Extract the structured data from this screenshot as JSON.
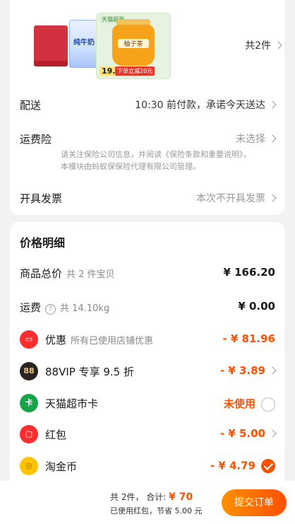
{
  "order_card": {
    "products": [
      {
        "name": "纯牛奶"
      },
      {
        "name": "柚子茶",
        "tag": "天猫超市",
        "price": "19.9",
        "promo": "下单立减20元"
      }
    ],
    "count_label": "共2件",
    "delivery": {
      "label": "配送",
      "value": "10:30 前付款，承诺今天送达"
    },
    "insurance": {
      "label": "运费险",
      "value": "未选择",
      "notice": "请关注保险公司信息，并阅读《保险条款和重要说明》，本模块由蚂蚁保保险代理有限公司管理。"
    },
    "invoice": {
      "label": "开具发票",
      "value": "本次不开具发票"
    }
  },
  "price_card": {
    "title": "价格明细",
    "items": [
      {
        "label": "商品总价",
        "sub": "共 2 件宝贝",
        "value": "¥ 166.20"
      },
      {
        "label": "运费",
        "sub": "共 14.10kg",
        "value": "¥ 0.00"
      },
      {
        "label": "优惠",
        "sub": "所有已使用店铺优惠",
        "value": "- ¥ 81.96",
        "icon": "ticket-icon"
      },
      {
        "label": "88VIP 专享 9.5 折",
        "value": "- ¥ 3.89",
        "icon": "88vip-icon"
      },
      {
        "label": "天猫超市卡",
        "value": "未使用",
        "icon": "supermarket-card-icon"
      },
      {
        "label": "红包",
        "value": "- ¥ 5.00",
        "icon": "red-packet-icon"
      },
      {
        "label": "淘金币",
        "value": "- ¥ 4.79",
        "icon": "coin-icon"
      }
    ]
  },
  "footer": {
    "count": "共 2件，",
    "total_label": "合计:",
    "total": "¥ 70",
    "saving": "已使用红包，节省 5.00 元",
    "submit": "提交订单"
  },
  "colors": {
    "accent": "#ff5000",
    "red": "#ff2d2d"
  }
}
